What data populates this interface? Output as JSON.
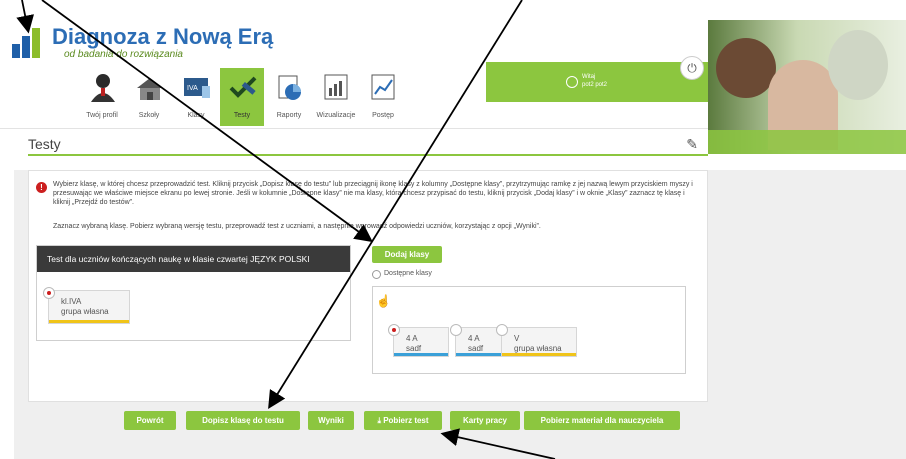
{
  "header": {
    "logo_title": "Diagnoza z Nową Erą",
    "logo_subtitle": "od badania do rozwiązania",
    "greeting_line1": "Witaj",
    "greeting_line2": "pot2 pot2"
  },
  "nav": {
    "items": [
      {
        "label": "Twój profil",
        "icon": "user-icon",
        "active": false
      },
      {
        "label": "Szkoły",
        "icon": "school-icon",
        "active": false
      },
      {
        "label": "Klasy",
        "icon": "class-icon",
        "active": false
      },
      {
        "label": "Testy",
        "icon": "pen-check-icon",
        "active": true
      },
      {
        "label": "Raporty",
        "icon": "report-icon",
        "active": false
      },
      {
        "label": "Wizualizacje",
        "icon": "chart-icon",
        "active": false
      },
      {
        "label": "Postęp",
        "icon": "progress-chart-icon",
        "active": false
      }
    ]
  },
  "page": {
    "title": "Testy",
    "info_paragraph1": "Wybierz klasę, w której chcesz przeprowadzić test. Kliknij przycisk „Dopisz klasę do testu” lub przeciągnij ikonę klasy z kolumny „Dostępne klasy”, przytrzymując ramkę z jej nazwą lewym przyciskiem myszy i przesuwając we właściwe miejsce ekranu po lewej stronie. Jeśli w kolumnie „Dostępne klasy” nie ma klasy, którą chcesz przypisać do testu, kliknij przycisk „Dodaj klasy” i w oknie „Klasy” zaznacz tę klasę i kliknij „Przejdź do testów”.",
    "info_paragraph2": "Zaznacz wybraną klasę. Pobierz wybraną wersję testu, przeprowadź test z uczniami, a następnie wprowadź odpowiedzi uczniów, korzystając z opcji „Wyniki”."
  },
  "test_box": {
    "heading": "Test dla uczniów kończących naukę w klasie czwartej JĘZYK POLSKI",
    "classes": [
      {
        "name": "kl.IVA",
        "group": "grupa własna",
        "selected": true,
        "color": "#f0c419"
      }
    ]
  },
  "available": {
    "add_button": "Dodaj klasy",
    "label": "Dostępne klasy",
    "classes": [
      {
        "name": "4 A",
        "group": "sadf",
        "selected": true,
        "color": "#3aa0d8"
      },
      {
        "name": "4 A",
        "group": "sadf",
        "selected": false,
        "color": "#3aa0d8"
      },
      {
        "name": "V",
        "group": "grupa własna",
        "selected": false,
        "color": "#f0c419"
      }
    ]
  },
  "buttons": {
    "back": "Powrót",
    "add_class_to_test": "Dopisz klasę do testu",
    "results": "Wyniki",
    "download_test": "Pobierz test",
    "worksheets": "Karty pracy",
    "teacher_material": "Pobierz materiał dla nauczyciela"
  },
  "colors": {
    "accent_green": "#8cc63f",
    "brand_blue": "#2c6db5",
    "alert_red": "#cc1f1f"
  }
}
